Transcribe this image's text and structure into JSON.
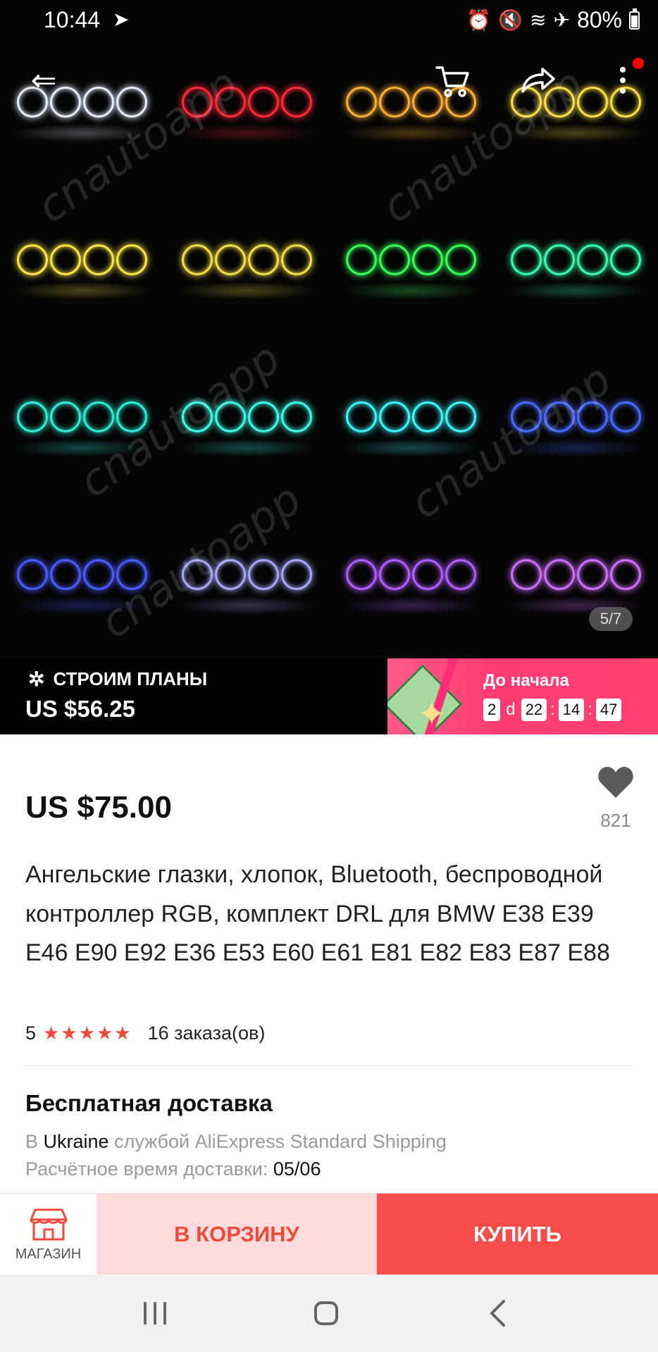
{
  "status_bar": {
    "time": "10:44",
    "battery": "80%",
    "icons": [
      "telegram-icon",
      "alarm-icon",
      "mute-icon",
      "wifi-icon",
      "airplane-icon",
      "battery-icon"
    ]
  },
  "gallery": {
    "watermark": "cnautoapp",
    "counter": "5/7",
    "ring_colors": [
      "#e8f0ff",
      "#ff2a3a",
      "#ffb13a",
      "#ffe14a",
      "#ffe84a",
      "#f6e14a",
      "#3aff5a",
      "#3affb0",
      "#30f0d8",
      "#40ffe8",
      "#40f6ff",
      "#4a6bff",
      "#4a5cff",
      "#a8a8ff",
      "#b060ff",
      "#d070ff"
    ]
  },
  "promo": {
    "title": "СТРОИМ ПЛАНЫ",
    "price": "US $56.25",
    "countdown_label": "До начала",
    "days": "2",
    "days_unit": "d",
    "hours": "22",
    "minutes": "14",
    "seconds": "47",
    "gradient_color": "#ff3c72"
  },
  "product": {
    "price": "US $75.00",
    "favorites": "821",
    "title": "Ангельские глазки, хлопок, Bluetooth, беспроводной контроллер RGB, комплект DRL для BMW E38 E39 E46 E90 E92 E36 E53 E60 E61 E81 E82 E83 E87 E88",
    "rating": "5",
    "rating_stars": 5,
    "orders": "16 заказа(ов)"
  },
  "shipping": {
    "title": "Бесплатная доставка",
    "line1_prefix": "В",
    "country": "Ukraine",
    "line1_suffix": "службой AliExpress Standard Shipping",
    "eta_label": "Расчётное время доставки:",
    "eta_date": "05/06"
  },
  "actions": {
    "store_label": "МАГАЗИН",
    "add_to_cart": "В КОРЗИНУ",
    "buy": "КУПИТЬ",
    "accent_color": "#f64c4a"
  }
}
